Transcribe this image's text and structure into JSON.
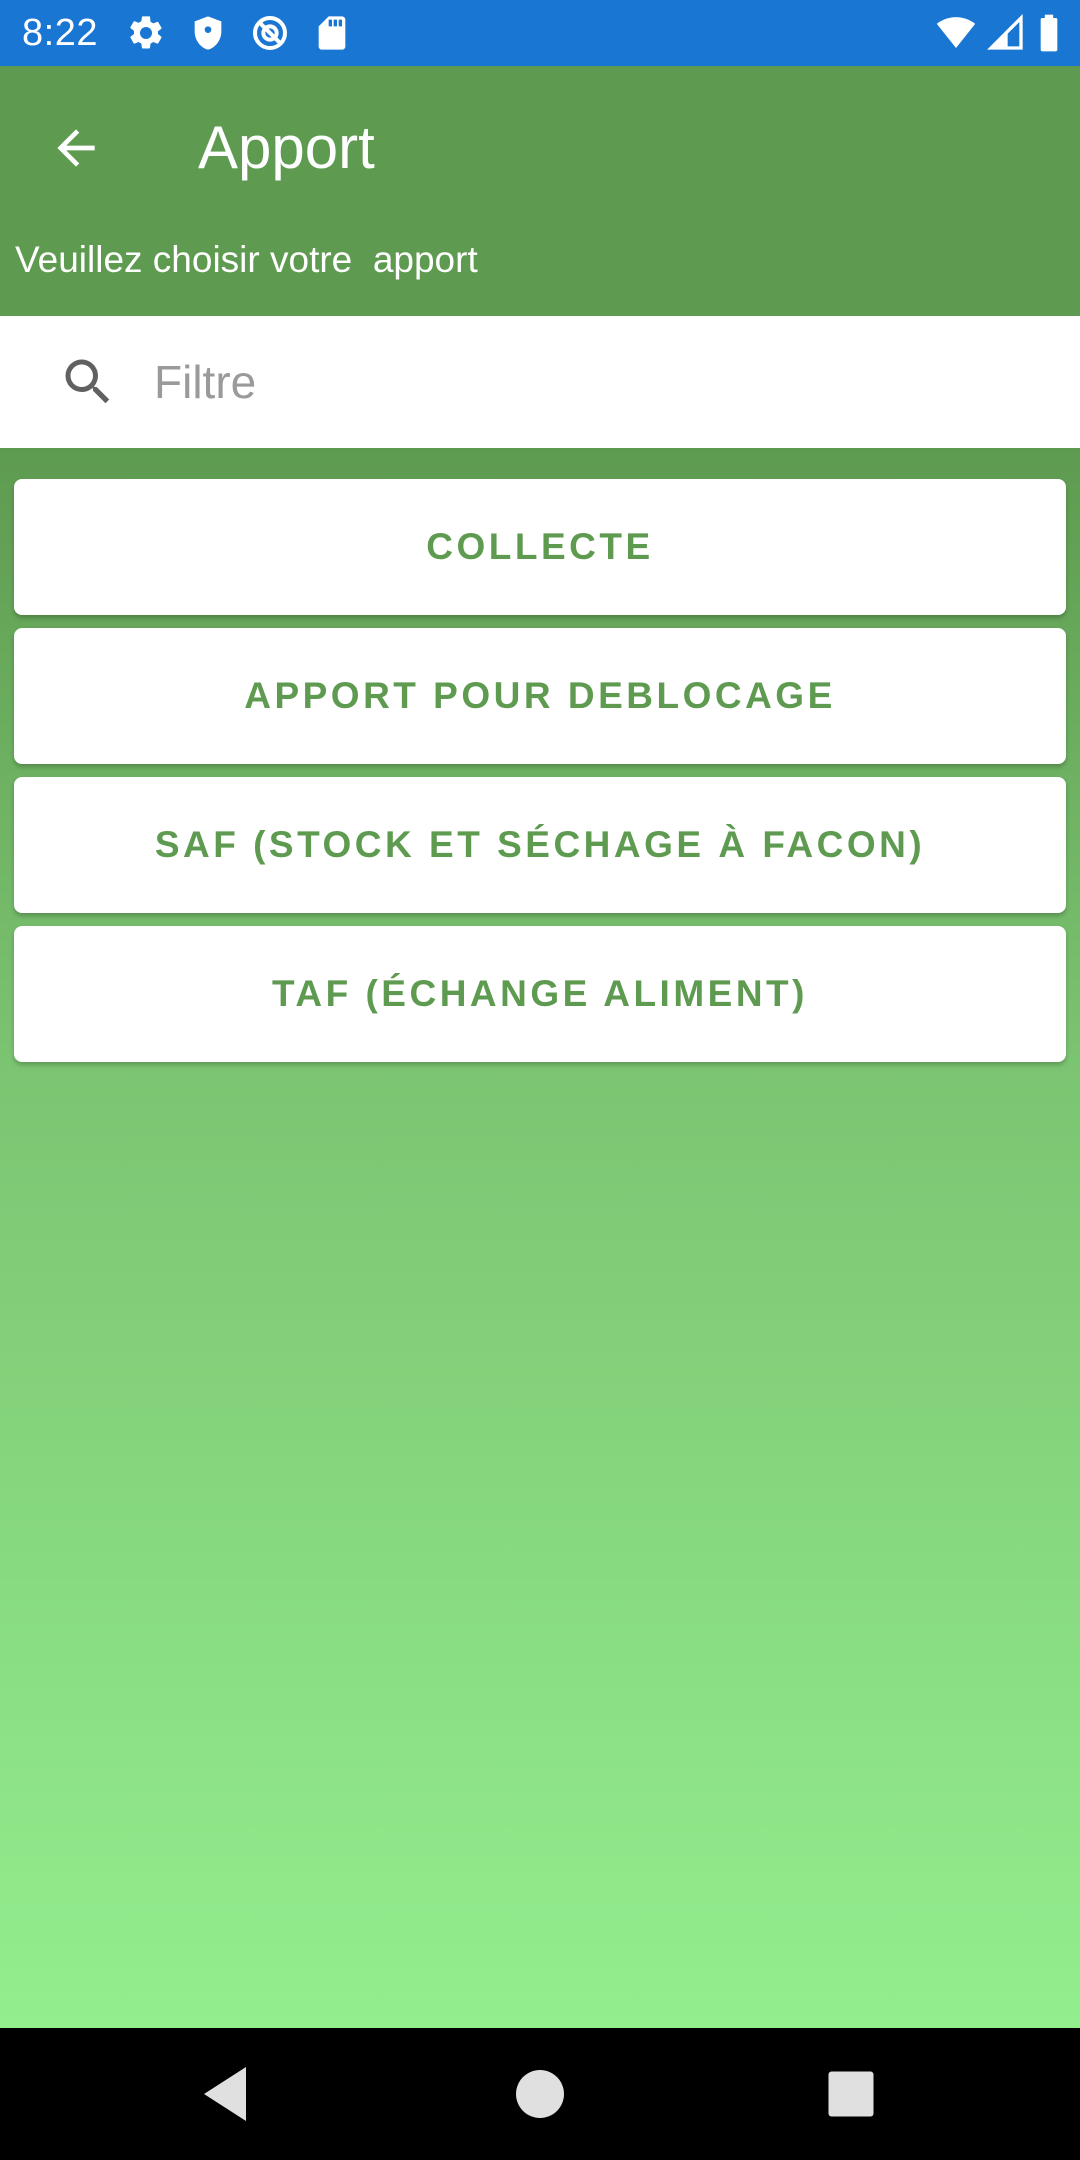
{
  "status_bar": {
    "time": "8:22",
    "left_icons": [
      "settings-icon",
      "shield-icon",
      "sync-blocked-icon",
      "sd-card-icon"
    ],
    "right_icons": [
      "wifi-icon",
      "signal-icon",
      "battery-icon"
    ]
  },
  "app_bar": {
    "back_icon": "arrow-back-icon",
    "title": "Apport",
    "subtitle": "Veuillez choisir votre  apport"
  },
  "search": {
    "icon": "search-icon",
    "placeholder": "Filtre",
    "value": ""
  },
  "options": [
    {
      "label": "COLLECTE"
    },
    {
      "label": "APPORT POUR DEBLOCAGE"
    },
    {
      "label": "SAF (STOCK ET SÉCHAGE À FACON)"
    },
    {
      "label": "TAF (ÉCHANGE ALIMENT)"
    }
  ],
  "nav_bar": {
    "back_icon": "nav-back-icon",
    "home_icon": "nav-home-icon",
    "recents_icon": "nav-recents-icon"
  },
  "colors": {
    "status_bar": "#1976d2",
    "app_bar": "#5e9b50",
    "button_text": "#5e9b50",
    "gradient_top": "#5e9b50",
    "gradient_bottom": "#93ee8d",
    "nav_bar": "#000000"
  }
}
